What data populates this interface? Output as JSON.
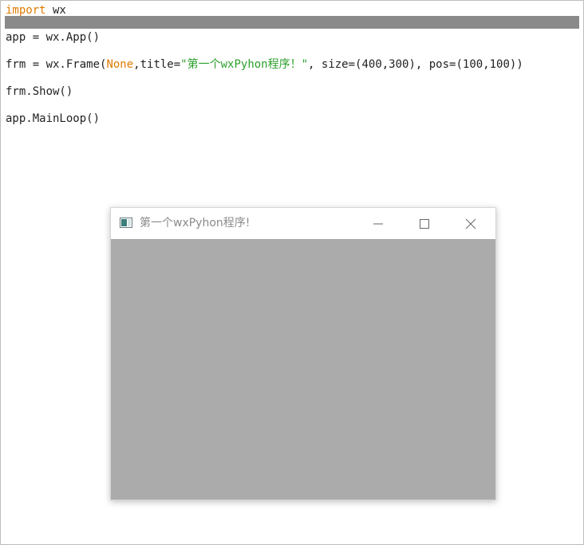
{
  "editor": {
    "line1": {
      "keyword": "import",
      "rest": " wx"
    },
    "line2": {
      "text": "app = wx.App()"
    },
    "line3": {
      "prefix": "frm = wx.Frame(",
      "none_kw": "None",
      "mid": ",title=",
      "string": "\"第一个wxPyhon程序！\"",
      "suffix": ", size=(400,300), pos=(100,100))"
    },
    "line4": {
      "text": "frm.Show()"
    },
    "line5": {
      "text": "app.MainLoop()"
    }
  },
  "window": {
    "title": "第一个wxPyhon程序!",
    "icon": "app-window-icon",
    "controls": [
      "minimize-icon",
      "maximize-icon",
      "close-icon"
    ],
    "client_color": "#ababab"
  },
  "colors": {
    "keyword": "#e07b00",
    "string": "#2ca02c",
    "highlight": "#8a8a8a"
  }
}
